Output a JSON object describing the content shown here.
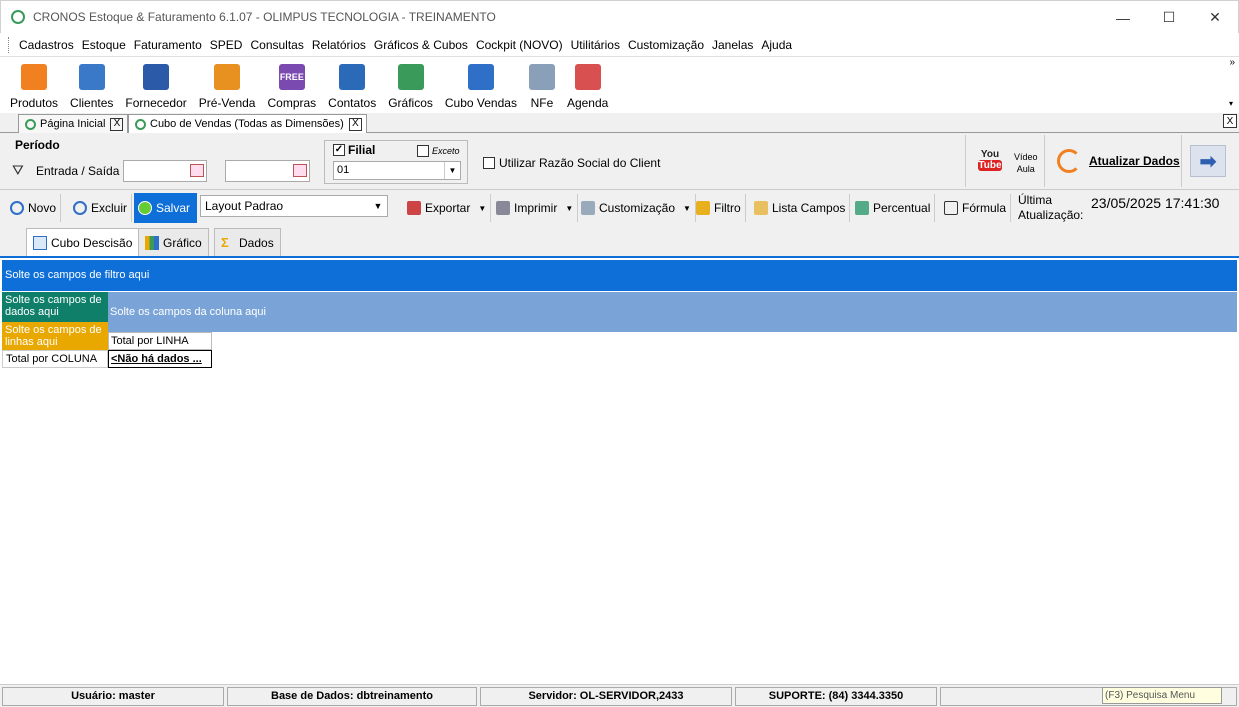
{
  "window": {
    "title": "CRONOS Estoque & Faturamento 6.1.07 - OLIMPUS TECNOLOGIA - TREINAMENTO",
    "minimize": "—",
    "maximize": "☐",
    "close": "✕"
  },
  "menu": [
    "Cadastros",
    "Estoque",
    "Faturamento",
    "SPED",
    "Consultas",
    "Relatórios",
    "Gráficos & Cubos",
    "Cockpit (NOVO)",
    "Utilitários",
    "Customização",
    "Janelas",
    "Ajuda"
  ],
  "toolbar": {
    "overflow": "»",
    "overflow_small": "▾",
    "items": [
      {
        "label": "Produtos",
        "icon": "box-icon",
        "color": "#f08020"
      },
      {
        "label": "Clientes",
        "icon": "people-icon",
        "color": "#3a78c8"
      },
      {
        "label": "Fornecedor",
        "icon": "worker-icon",
        "color": "#2a5aa8"
      },
      {
        "label": "Pré-Venda",
        "icon": "cart-icon",
        "color": "#e89020"
      },
      {
        "label": "Compras",
        "icon": "truck-icon",
        "color": "#7a4ab0",
        "icon_text": "FREE"
      },
      {
        "label": "Contatos",
        "icon": "contact-icon",
        "color": "#2a6ab8"
      },
      {
        "label": "Gráficos",
        "icon": "chart-icon",
        "color": "#3a9a5a"
      },
      {
        "label": "Cubo Vendas",
        "icon": "dashboard-icon",
        "color": "#2f6fc8"
      },
      {
        "label": "NFe",
        "icon": "nfe-icon",
        "color": "#8aa0b8"
      },
      {
        "label": "Agenda",
        "icon": "calendar-icon",
        "color": "#d85050"
      }
    ]
  },
  "doc_tabs": [
    {
      "label": "Página Inicial",
      "close": "X"
    },
    {
      "label": "Cubo de Vendas (Todas as Dimensões)",
      "close": "X"
    }
  ],
  "doc_tabs_close": "X",
  "filters": {
    "periodo_label": "Período",
    "entrada_saida_label": "Entrada / Saída",
    "date_from": "",
    "date_to": "",
    "filial_label": "Filial",
    "filial_checked": "✓",
    "exceto_label": "Exceto",
    "filial_value": "01",
    "razao_social_label": "Utilizar Razão Social do Client",
    "youtube_you": "You",
    "youtube_tube": "Tube",
    "video_label": "Vídeo",
    "aula_label": "Aula",
    "atualizar_label": "Atualizar Dados",
    "go_arrow": "➡"
  },
  "actions": {
    "novo": "Novo",
    "excluir": "Excluir",
    "salvar": "Salvar",
    "layout_value": "Layout Padrao",
    "exportar": "Exportar",
    "imprimir": "Imprimir",
    "customizacao": "Customização",
    "filtro": "Filtro",
    "lista_campos": "Lista Campos",
    "percentual": "Percentual",
    "formula": "Fórmula",
    "ultima_label_1": "Última",
    "ultima_label_2": "Atualização:",
    "ultima_value": "23/05/2025 17:41:30",
    "dropdown_arrow": "▼"
  },
  "view_tabs": [
    "Cubo Descisão",
    "Gráfico",
    "Dados"
  ],
  "cube": {
    "filter_zone": "Solte os campos de filtro aqui",
    "data_zone": "Solte os campos de dados aqui",
    "column_zone": "Solte os campos da coluna aqui",
    "row_zone": "Solte os campos de linhas aqui",
    "total_linha": "Total por LINHA",
    "total_coluna": "Total por COLUNA",
    "no_data": "<Não há dados ..."
  },
  "status": {
    "usuario": "Usuário: master",
    "base": "Base de Dados: dbtreinamento",
    "servidor": "Servidor: OL-SERVIDOR,2433",
    "suporte": "SUPORTE: (84) 3344.3350",
    "search_placeholder": "(F3) Pesquisa Menu"
  }
}
